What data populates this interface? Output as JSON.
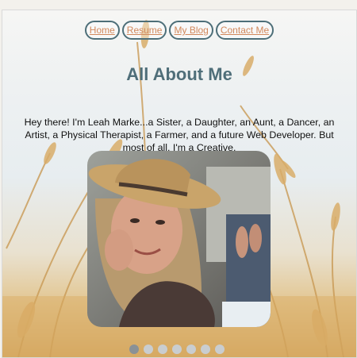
{
  "nav": {
    "items": [
      {
        "label": "Home"
      },
      {
        "label": "Resume"
      },
      {
        "label": "My Blog"
      },
      {
        "label": "Contact Me"
      }
    ]
  },
  "main": {
    "title": "All About Me",
    "intro": "Hey there! I'm Leah Marke...a Sister, a Daughter, an Aunt, a Dancer, an Artist, a Physical Therapist, a Farmer, and a future Web Developer. But most of all, I'm a Creative."
  },
  "carousel": {
    "slide_count": 7,
    "active_index": 0
  },
  "colors": {
    "accent": "#4f6e79",
    "link": "#d1885c"
  }
}
